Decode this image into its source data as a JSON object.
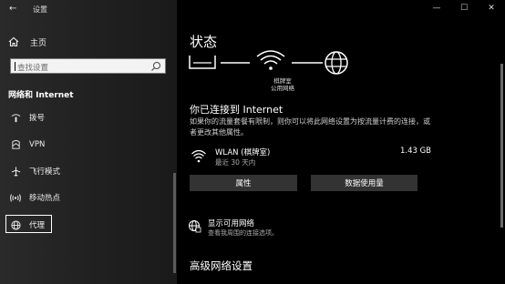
{
  "window": {
    "title": "设置",
    "controls": {
      "minimize": "—",
      "maximize": "☐",
      "close": "✕"
    }
  },
  "sidebar": {
    "home_label": "主页",
    "search_placeholder": "查找设置",
    "section_title": "网络和 Internet",
    "items": [
      {
        "label": "拨号",
        "icon": "dialup-icon"
      },
      {
        "label": "VPN",
        "icon": "vpn-icon"
      },
      {
        "label": "飞行模式",
        "icon": "airplane-icon"
      },
      {
        "label": "移动热点",
        "icon": "hotspot-icon"
      },
      {
        "label": "代理",
        "icon": "globe-icon",
        "selected": true
      }
    ]
  },
  "main": {
    "title": "状态",
    "network_name_lines": [
      "棋牌室",
      "公用网络"
    ],
    "connected_heading": "你已连接到 Internet",
    "description": "如果你的流量套餐有限制，则你可以将此网络设置为按流量计费的连接，或者更改其他属性。",
    "connection": {
      "name": "WLAN (棋牌室)",
      "period": "最近 30 天内",
      "usage": "1.43 GB"
    },
    "buttons": {
      "properties": "属性",
      "data_usage": "数据使用量"
    },
    "show_networks": {
      "title": "显示可用网络",
      "subtitle": "查看我周围的连接选项。"
    },
    "advanced_heading": "高级网络设置"
  },
  "colors": {
    "background": "#000000",
    "sidebar": "#202020",
    "button": "#333333",
    "search_bg": "#f3f3f3"
  }
}
